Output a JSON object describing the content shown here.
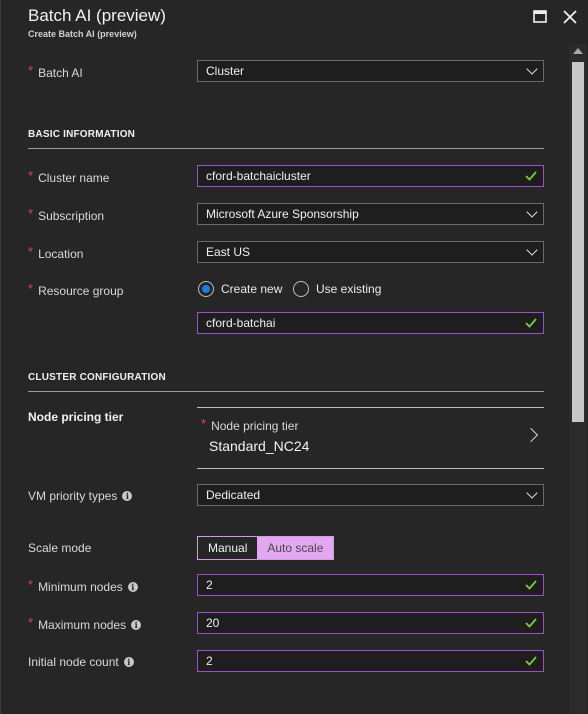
{
  "window": {
    "title": "Batch AI (preview)",
    "subtitle": "Create Batch AI (preview)"
  },
  "batch_ai": {
    "label": "Batch AI",
    "value": "Cluster"
  },
  "basic": {
    "section_title": "BASIC INFORMATION",
    "cluster_name": {
      "label": "Cluster name",
      "value": "cford-batchaicluster"
    },
    "subscription": {
      "label": "Subscription",
      "value": "Microsoft Azure Sponsorship"
    },
    "location": {
      "label": "Location",
      "value": "East US"
    },
    "resource_group": {
      "label": "Resource group",
      "options": [
        "Create new",
        "Use existing"
      ],
      "selected": "Create new",
      "value": "cford-batchai"
    }
  },
  "cluster": {
    "section_title": "CLUSTER CONFIGURATION",
    "node_pricing": {
      "section_label": "Node pricing tier",
      "field_label": "Node pricing tier",
      "value": "Standard_NC24"
    },
    "vm_priority": {
      "label": "VM priority types",
      "value": "Dedicated"
    },
    "scale_mode": {
      "label": "Scale mode",
      "options": [
        "Manual",
        "Auto scale"
      ],
      "selected": "Manual"
    },
    "min_nodes": {
      "label": "Minimum nodes",
      "value": "2"
    },
    "max_nodes": {
      "label": "Maximum nodes",
      "value": "20"
    },
    "initial_count": {
      "label": "Initial node count",
      "value": "2"
    }
  },
  "colors": {
    "background": "#262626",
    "required": "#e0414a",
    "valid_border": "#9c4fc9",
    "check": "#7cc840",
    "radio_selected": "#1c7ee0",
    "segment_highlight": "#e3a7f2"
  },
  "icons": {
    "maximize": "maximize-icon",
    "close": "close-icon",
    "check": "check-icon",
    "dropdown": "chevron-down-icon",
    "info": "info-icon",
    "navigate": "chevron-right-icon"
  }
}
